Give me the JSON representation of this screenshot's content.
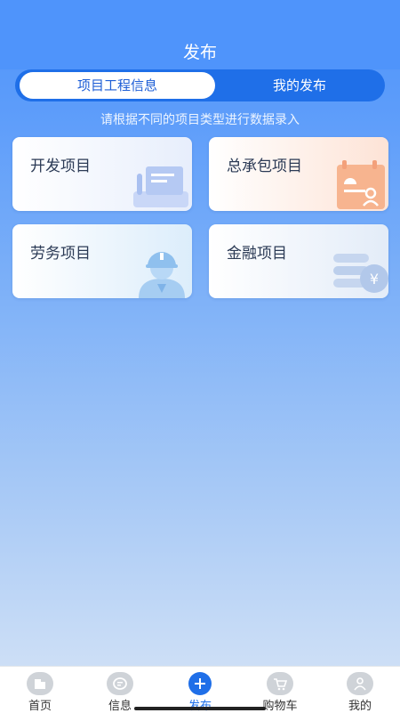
{
  "header": {
    "title": "发布"
  },
  "segment": {
    "tabs": [
      {
        "label": "项目工程信息"
      },
      {
        "label": "我的发布"
      }
    ]
  },
  "hint": "请根据不同的项目类型进行数据录入",
  "cards": [
    {
      "label": "开发项目",
      "icon": "document-illustration-icon"
    },
    {
      "label": "总承包项目",
      "icon": "contract-illustration-icon"
    },
    {
      "label": "劳务项目",
      "icon": "worker-illustration-icon"
    },
    {
      "label": "金融项目",
      "icon": "coins-illustration-icon"
    }
  ],
  "tabbar": {
    "items": [
      {
        "label": "首页",
        "icon": "home-icon"
      },
      {
        "label": "信息",
        "icon": "message-icon"
      },
      {
        "label": "发布",
        "icon": "plus-icon"
      },
      {
        "label": "购物车",
        "icon": "cart-icon"
      },
      {
        "label": "我的",
        "icon": "user-icon"
      }
    ]
  },
  "colors": {
    "primary": "#1f6fe8",
    "header": "#4f94fb",
    "inactive_icon": "#cfd3d8"
  }
}
